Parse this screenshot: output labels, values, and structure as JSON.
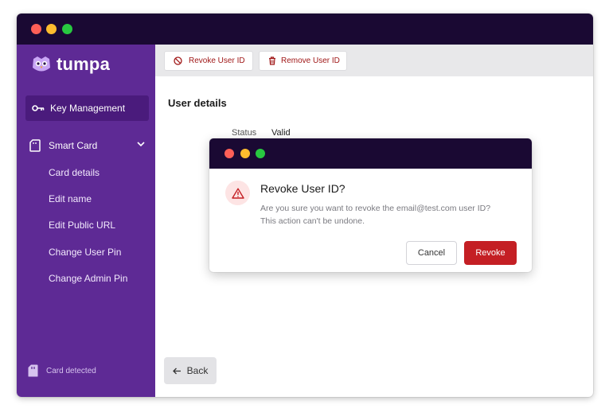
{
  "colors": {
    "titlebar": "#1a0933",
    "sidebar": "#5e2a95",
    "sidebar_active": "#4a1b7c",
    "danger": "#c41f24",
    "dot_red": "#fe5f57",
    "dot_yellow": "#febc2e",
    "dot_green": "#28c840"
  },
  "app": {
    "name": "tumpa"
  },
  "sidebar": {
    "key_management": {
      "label": "Key Management",
      "icon": "key-icon"
    },
    "smart_card": {
      "label": "Smart Card",
      "icon": "sd-card-icon",
      "expanded": true,
      "items": [
        "Card details",
        "Edit name",
        "Edit Public URL",
        "Change User Pin",
        "Change Admin Pin"
      ]
    },
    "card_status": {
      "label": "Card detected",
      "icon": "sd-card-icon"
    }
  },
  "toolbar": {
    "revoke_label": "Revoke User ID",
    "revoke_icon": "block-icon",
    "remove_label": "Remove User ID",
    "remove_icon": "trash-icon"
  },
  "main": {
    "heading": "User details",
    "status_label": "Status",
    "status_value": "Valid",
    "back_label": "Back"
  },
  "dialog": {
    "title": "Revoke User ID?",
    "message_line1": "Are you sure you want to revoke the email@test.com user ID?",
    "message_line2": "This action can't be undone.",
    "cancel_label": "Cancel",
    "confirm_label": "Revoke",
    "icon": "warning-icon"
  }
}
